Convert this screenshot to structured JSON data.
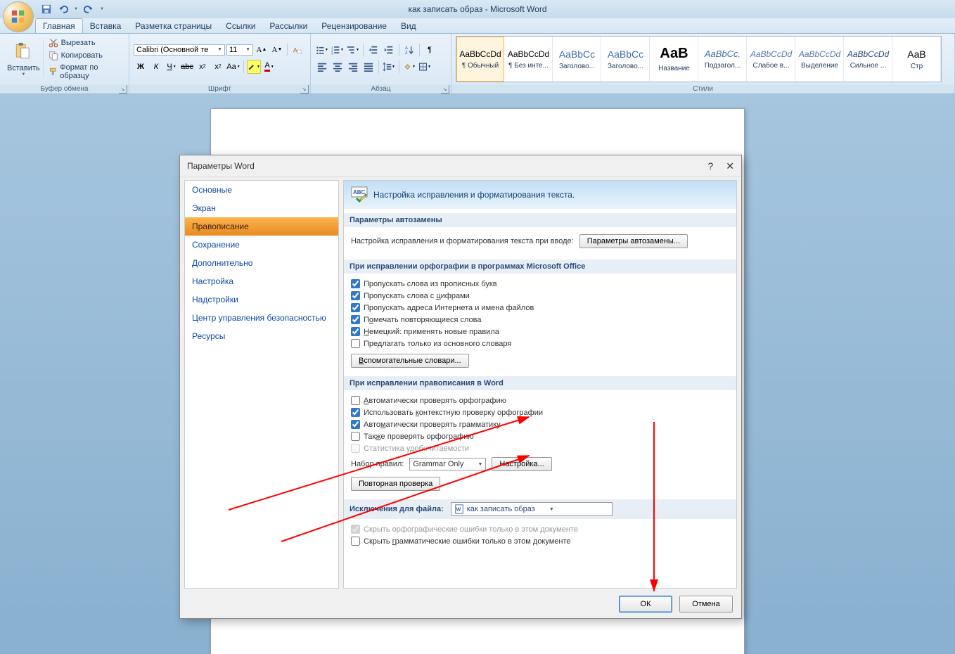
{
  "app": {
    "doc_title": "как записать образ - Microsoft Word"
  },
  "tabs": {
    "home": "Главная",
    "insert": "Вставка",
    "layout": "Разметка страницы",
    "refs": "Ссылки",
    "mail": "Рассылки",
    "review": "Рецензирование",
    "view": "Вид"
  },
  "clipboard": {
    "paste": "Вставить",
    "cut": "Вырезать",
    "copy": "Копировать",
    "fmt": "Формат по образцу",
    "label": "Буфер обмена"
  },
  "font": {
    "name": "Calibri (Основной те",
    "size": "11",
    "label": "Шрифт"
  },
  "para": {
    "label": "Абзац"
  },
  "styles": {
    "label": "Стили",
    "items": [
      {
        "sample": "AaBbCcDd",
        "name": "¶ Обычный"
      },
      {
        "sample": "AaBbCcDd",
        "name": "¶ Без инте..."
      },
      {
        "sample": "AaBbCc",
        "name": "Заголово..."
      },
      {
        "sample": "AaBbCc",
        "name": "Заголово..."
      },
      {
        "sample": "АаВ",
        "name": "Название"
      },
      {
        "sample": "AaBbCc.",
        "name": "Подзагол..."
      },
      {
        "sample": "AaBbCcDd",
        "name": "Слабое в..."
      },
      {
        "sample": "AaBbCcDd",
        "name": "Выделение"
      },
      {
        "sample": "AaBbCcDd",
        "name": "Сильное ..."
      },
      {
        "sample": "AaB",
        "name": "Стр"
      }
    ]
  },
  "dialog": {
    "title": "Параметры Word",
    "nav": {
      "main": "Основные",
      "screen": "Экран",
      "spelling": "Правописание",
      "save": "Сохранение",
      "advanced": "Дополнительно",
      "customize": "Настройка",
      "addins": "Надстройки",
      "trust": "Центр управления безопасностью",
      "resources": "Ресурсы"
    },
    "header": "Настройка исправления и форматирования текста.",
    "s1": {
      "title": "Параметры автозамены",
      "text": "Настройка исправления и форматирования текста при вводе:",
      "btn": "Параметры автозамены..."
    },
    "s2": {
      "title": "При исправлении орфографии в программах Microsoft Office",
      "c1": "Пропускать слова из прописных букв",
      "c2": "Пропускать слова с цифрами",
      "c3": "Пропускать адреса Интернета и имена файлов",
      "c4": "Помечать повторяющиеся слова",
      "c5": "Немецкий: применять новые правила",
      "c6": "Предлагать только из основного словаря",
      "btn": "Вспомогательные словари..."
    },
    "s3": {
      "title": "При исправлении правописания в Word",
      "c1": "Автоматически проверять орфографию",
      "c2": "Использовать контекстную проверку орфографии",
      "c3": "Автоматически проверять грамматику",
      "c4": "Также проверять орфографию",
      "c5": "Статистика удобочитаемости",
      "rules_lbl": "Набор правил:",
      "rules_val": "Grammar Only",
      "settings_btn": "Настройка...",
      "recheck": "Повторная проверка"
    },
    "s4": {
      "title": "Исключения для файла:",
      "file": "как записать образ",
      "c1": "Скрыть орфографические ошибки только в этом документе",
      "c2": "Скрыть грамматические ошибки только в этом документе"
    },
    "ok": "ОК",
    "cancel": "Отмена"
  }
}
